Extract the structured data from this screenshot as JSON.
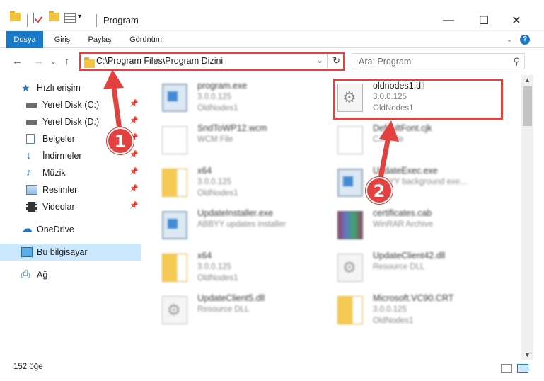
{
  "window": {
    "title": "Program",
    "minimize": "—",
    "maximize": "☐",
    "close": "✕"
  },
  "ribbon": {
    "tabs": [
      {
        "label": "Dosya"
      },
      {
        "label": "Giriş"
      },
      {
        "label": "Paylaş"
      },
      {
        "label": "Görünüm"
      }
    ],
    "expand_glyph": "⌄",
    "help": "?"
  },
  "nav": {
    "back": "←",
    "forward": "→",
    "dropdown": "⌄",
    "up": "↑",
    "address": "C:\\Program Files\\Program Dizini",
    "address_drop": "⌄",
    "refresh": "↻",
    "search_placeholder": "Ara: Program",
    "search_icon": "⚲"
  },
  "sidebar": {
    "items": [
      {
        "label": "Hızlı erişim",
        "icon": "star-icon"
      },
      {
        "label": "Yerel Disk (C:)",
        "icon": "drive-icon",
        "pin": "📌"
      },
      {
        "label": "Yerel Disk (D:)",
        "icon": "drive-icon",
        "pin": "📌"
      },
      {
        "label": "Belgeler",
        "icon": "documents-icon",
        "pin": "📌"
      },
      {
        "label": "İndirmeler",
        "icon": "download-icon",
        "pin": "📌"
      },
      {
        "label": "Müzik",
        "icon": "music-icon",
        "pin": "📌"
      },
      {
        "label": "Resimler",
        "icon": "pictures-icon",
        "pin": "📌"
      },
      {
        "label": "Videolar",
        "icon": "videos-icon",
        "pin": "📌"
      },
      {
        "label": "OneDrive",
        "icon": "cloud-icon"
      },
      {
        "label": "Bu bilgisayar",
        "icon": "computer-icon"
      },
      {
        "label": "Ağ",
        "icon": "network-icon"
      }
    ]
  },
  "files": [
    {
      "name": "program.exe",
      "l2": "3.0.0.125",
      "l3": "OldNodes1",
      "icon": "exe"
    },
    {
      "name": "oldnodes1.dll",
      "l2": "3.0.0.125",
      "l3": "OldNodes1",
      "icon": "dll"
    },
    {
      "name": "SndToWP12.wcm",
      "l2": "WCM File",
      "l3": "",
      "icon": "doc"
    },
    {
      "name": "DefaultFont.cjk",
      "l2": "CJK File",
      "l3": "",
      "icon": "doc"
    },
    {
      "name": "x64",
      "l2": "3.0.0.125",
      "l3": "OldNodes1",
      "icon": "folder"
    },
    {
      "name": "UpdateExec.exe",
      "l2": "ABBYY background exe...",
      "l3": "",
      "icon": "exe"
    },
    {
      "name": "UpdateInstaller.exe",
      "l2": "ABBYY updates installer",
      "l3": "",
      "icon": "exe"
    },
    {
      "name": "certificates.cab",
      "l2": "WinRAR Archive",
      "l3": "",
      "icon": "cab"
    },
    {
      "name": "x64",
      "l2": "3.0.0.125",
      "l3": "OldNodes1",
      "icon": "folder"
    },
    {
      "name": "UpdateClient42.dll",
      "l2": "Resource DLL",
      "l3": "",
      "icon": "dll"
    },
    {
      "name": "UpdateClient5.dll",
      "l2": "Resource DLL",
      "l3": "",
      "icon": "dll"
    },
    {
      "name": "Microsoft.VC90.CRT",
      "l2": "3.0.0.125",
      "l3": "OldNodes1",
      "icon": "folder"
    }
  ],
  "callouts": {
    "one": "1",
    "two": "2"
  },
  "status": {
    "count": "152 öğe"
  },
  "colors": {
    "accent": "#1979ca",
    "highlight": "#e2413f",
    "selection": "#cce8ff"
  }
}
